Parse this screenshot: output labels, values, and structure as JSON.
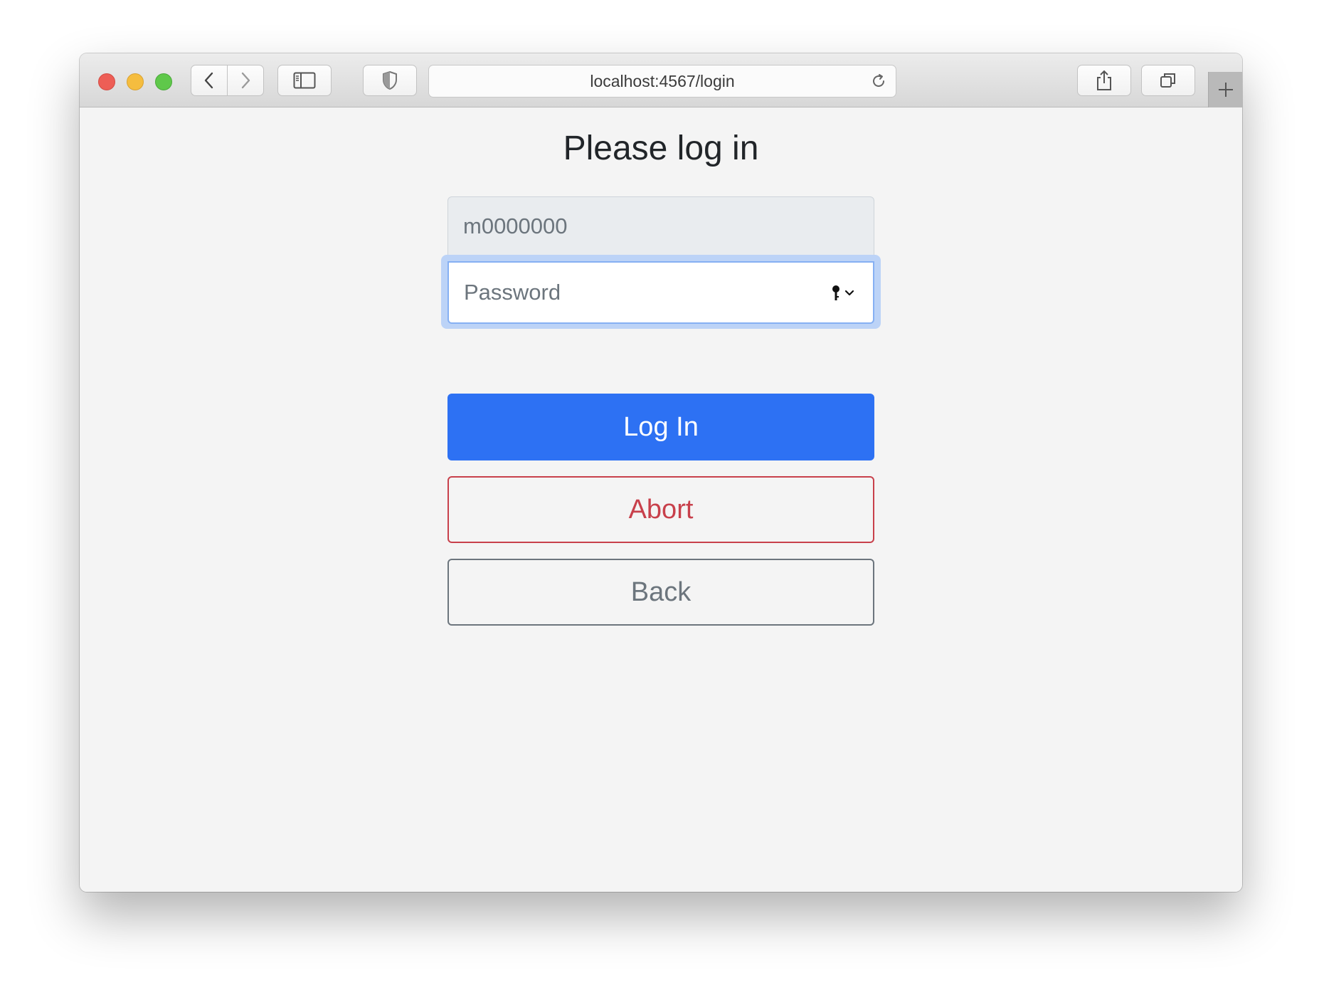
{
  "browser": {
    "url": "localhost:4567/login",
    "icons": [
      "close-light",
      "minimize-light",
      "zoom-light",
      "chevron-left-icon",
      "chevron-right-icon",
      "sidebar-icon",
      "shield-icon",
      "reload-icon",
      "share-icon",
      "tabs-icon",
      "plus-icon"
    ]
  },
  "page": {
    "title": "Please log in",
    "username": {
      "value": "m0000000"
    },
    "password": {
      "placeholder": "Password",
      "value": ""
    },
    "buttons": {
      "login": "Log In",
      "abort": "Abort",
      "back": "Back"
    }
  },
  "colors": {
    "primary": "#2d71f3",
    "danger": "#c8404b",
    "secondary": "#6c757d",
    "focus_ring": "#bcd3f7"
  }
}
